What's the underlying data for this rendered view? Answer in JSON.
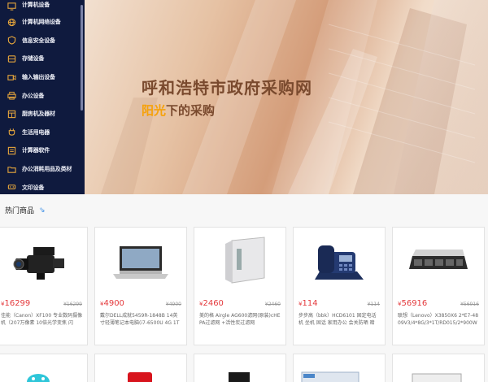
{
  "sidebar": {
    "items": [
      {
        "label": "计算机设备",
        "icon": "monitor-icon"
      },
      {
        "label": "计算机网络设备",
        "icon": "network-icon"
      },
      {
        "label": "信息安全设备",
        "icon": "shield-icon"
      },
      {
        "label": "存储设备",
        "icon": "storage-icon"
      },
      {
        "label": "输入输出设备",
        "icon": "camera-icon"
      },
      {
        "label": "办公设备",
        "icon": "printer-icon"
      },
      {
        "label": "厨房机及器材",
        "icon": "kitchen-icon"
      },
      {
        "label": "生活用电器",
        "icon": "appliance-icon"
      },
      {
        "label": "计算器软件",
        "icon": "software-icon"
      },
      {
        "label": "办公消耗用品及类材",
        "icon": "folder-icon"
      },
      {
        "label": "文印设备",
        "icon": "print-device-icon"
      }
    ]
  },
  "banner": {
    "title": "呼和浩特市政府采购网",
    "subtitle_highlight": "阳光",
    "subtitle_rest": "下的采购"
  },
  "hot": {
    "title": "热门商品",
    "arrow": "⇘"
  },
  "products": [
    {
      "price": "16299",
      "old_price": "¥16299",
      "name": "佳能（Canon）XF100 专业数码摄像机（207万像素 10倍光学变焦 闪"
    },
    {
      "price": "4900",
      "old_price": "¥4900",
      "name": "戴尔DELL成就5459R-1848B 14英寸轻薄笔记本电脑(i7-6500U 4G 1T"
    },
    {
      "price": "2460",
      "old_price": "¥2460",
      "name": "美的格 Airgle AG600滤网(原装)cHEPA过滤网 +活性炭过滤网"
    },
    {
      "price": "114",
      "old_price": "¥114",
      "name": "步步高（bbk）HCD6101 固定电话机 坐机 固话 家用办公 会关防晒 暗"
    },
    {
      "price": "56916",
      "old_price": "¥56916",
      "name": "联想（Lenovo）X3850X6 2*E7-4809V3/4*8G/3*1T/RD015/2*900W"
    }
  ],
  "currency": "¥",
  "colors": {
    "sidebar_bg": "#0f1a3e",
    "price": "#e4393c",
    "highlight": "#f6a20b",
    "banner_title": "#7a4a2e"
  }
}
